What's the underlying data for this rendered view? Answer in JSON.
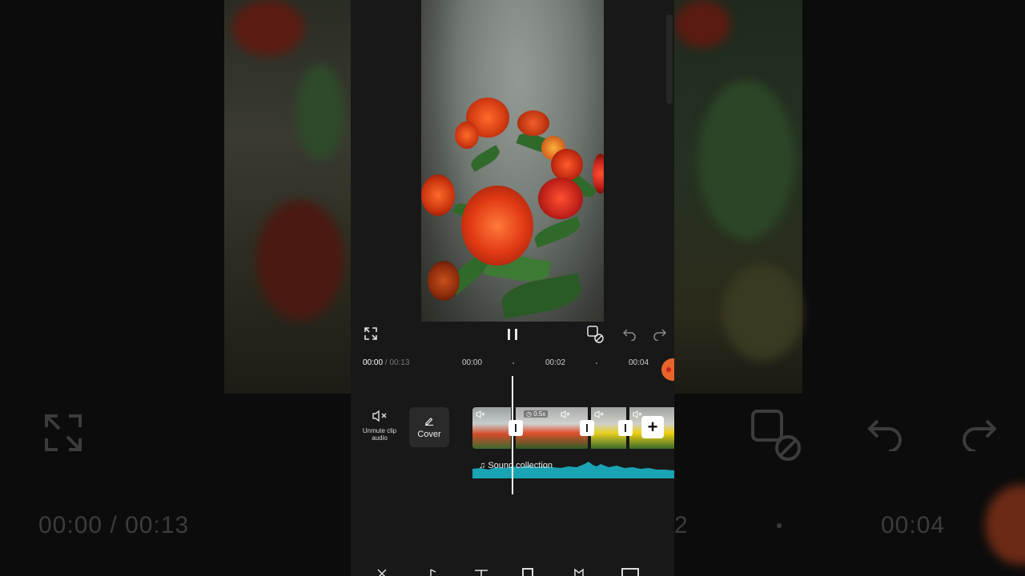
{
  "player": {
    "current_time": "00:00",
    "separator": "/",
    "total_time": "00:13"
  },
  "ruler": {
    "ticks": [
      "00:00",
      "00:02",
      "00:04"
    ]
  },
  "side_actions": {
    "unmute_label": "Unmute clip audio",
    "cover_label": "Cover"
  },
  "clips": {
    "speed_label": "0.5x"
  },
  "audio_track": {
    "label": "Sound collection",
    "color": "#1aa3b3"
  },
  "background": {
    "current_time": "00:00",
    "separator": "/",
    "total_time": "00:13",
    "right_time": "00:04",
    "right_partial": "2"
  },
  "icons": {
    "fullscreen": "expand-icon",
    "play_pause": "pause-icon",
    "keyframe": "keyframe-icon",
    "undo": "undo-icon",
    "redo": "redo-icon",
    "add": "plus-icon",
    "music": "music-note-icon",
    "speaker_muted": "speaker-muted-icon",
    "edit": "pencil-icon"
  }
}
